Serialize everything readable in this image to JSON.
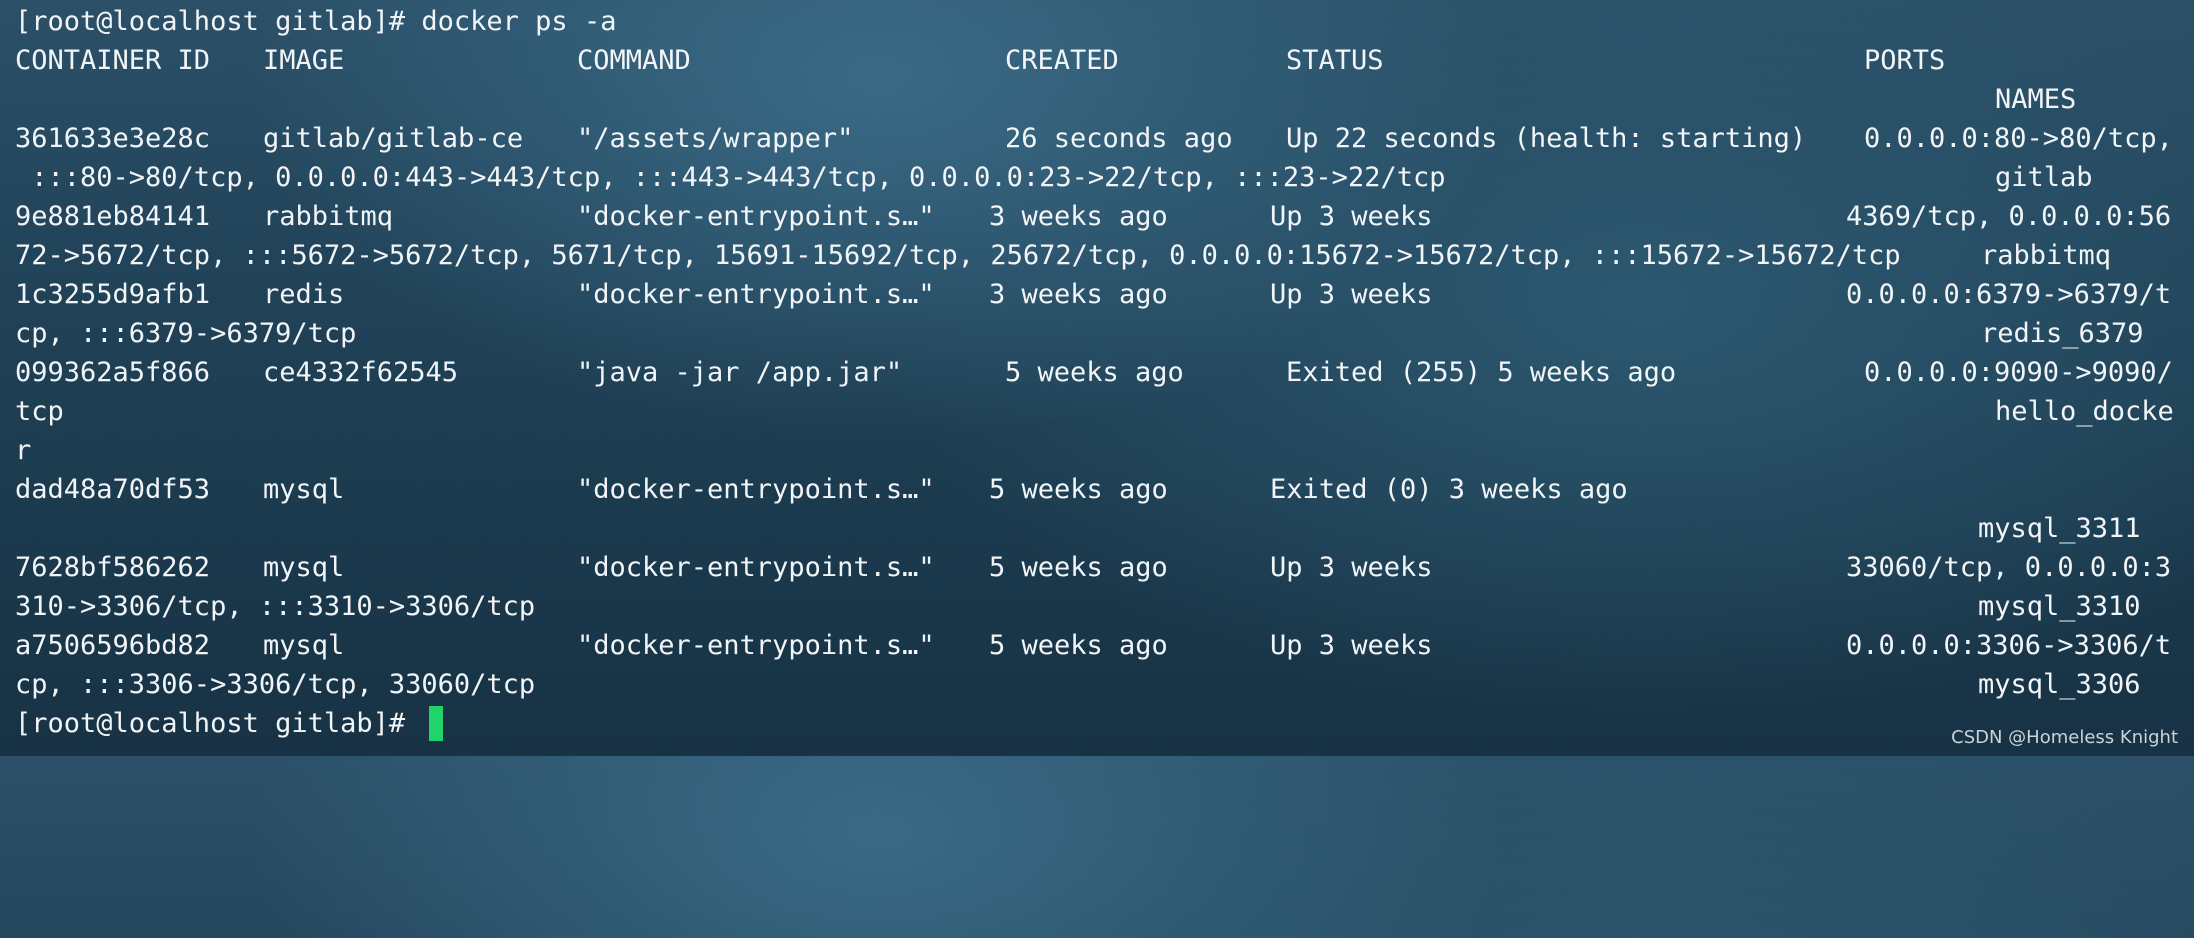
{
  "terminal": {
    "prompt_line": "[root@localhost gitlab]# docker ps -a",
    "final_prompt": "[root@localhost gitlab]# ",
    "cursor_color": "#21d36b",
    "text_color": "#f2f5f7"
  },
  "headers": {
    "container_id": "CONTAINER ID",
    "image": "IMAGE",
    "command": "COMMAND",
    "created": "CREATED",
    "status": "STATUS",
    "ports": "PORTS",
    "names": "NAMES"
  },
  "containers": [
    {
      "id": "361633e3e28c",
      "image": "gitlab/gitlab-ce",
      "command": "\"/assets/wrapper\"",
      "created": "26 seconds ago",
      "status": "Up 22 seconds (health: starting)",
      "ports_1": "0.0.0.0:80->80/tcp,",
      "ports_2": " :::80->80/tcp, 0.0.0.0:443->443/tcp, :::443->443/tcp, 0.0.0.0:23->22/tcp, :::23->22/tcp",
      "name": "gitlab"
    },
    {
      "id": "9e881eb84141",
      "image": "rabbitmq",
      "command": "\"docker-entrypoint.s…\"",
      "created": "3 weeks ago",
      "status": "Up 3 weeks",
      "ports_1": "4369/tcp, 0.0.0.0:56",
      "ports_2": "72->5672/tcp, :::5672->5672/tcp, 5671/tcp, 15691-15692/tcp, 25672/tcp, 0.0.0.0:15672->15672/tcp, :::15672->15672/tcp",
      "name": "rabbitmq"
    },
    {
      "id": "1c3255d9afb1",
      "image": "redis",
      "command": "\"docker-entrypoint.s…\"",
      "created": "3 weeks ago",
      "status": "Up 3 weeks",
      "ports_1": "0.0.0.0:6379->6379/t",
      "ports_2": "cp, :::6379->6379/tcp",
      "name": "redis_6379"
    },
    {
      "id": "099362a5f866",
      "image": "ce4332f62545",
      "command": "\"java -jar /app.jar\"",
      "created": "5 weeks ago",
      "status": "Exited (255) 5 weeks ago",
      "ports_1": "0.0.0.0:9090->9090/",
      "ports_2": "tcp",
      "name": "hello_docke",
      "name_wrap": "r"
    },
    {
      "id": "dad48a70df53",
      "image": "mysql",
      "command": "\"docker-entrypoint.s…\"",
      "created": "5 weeks ago",
      "status": "Exited (0) 3 weeks ago",
      "name": "mysql_3311"
    },
    {
      "id": "7628bf586262",
      "image": "mysql",
      "command": "\"docker-entrypoint.s…\"",
      "created": "5 weeks ago",
      "status": "Up 3 weeks",
      "ports_1": "33060/tcp, 0.0.0.0:3",
      "ports_2": "310->3306/tcp, :::3310->3306/tcp",
      "name": "mysql_3310"
    },
    {
      "id": "a7506596bd82",
      "image": "mysql",
      "command": "\"docker-entrypoint.s…\"",
      "created": "5 weeks ago",
      "status": "Up 3 weeks",
      "ports_1": "0.0.0.0:3306->3306/t",
      "ports_2": "cp, :::3306->3306/tcp, 33060/tcp",
      "name": "mysql_3306"
    }
  ],
  "watermark": "CSDN @Homeless Knight"
}
